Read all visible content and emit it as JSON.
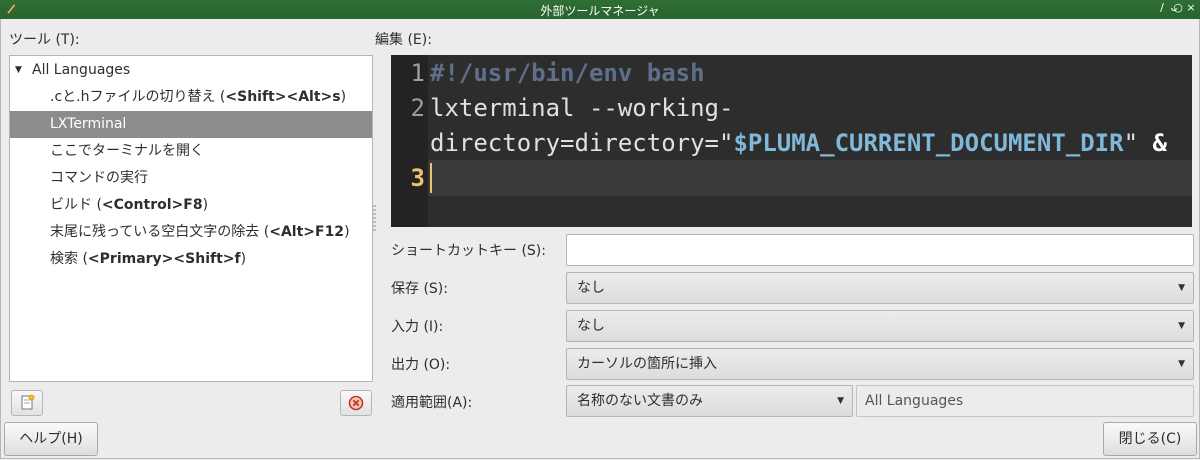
{
  "window": {
    "title": "外部ツールマネージャ",
    "controls": [
      "∕",
      "ᴗ",
      "○",
      "×"
    ]
  },
  "tools_label": "ツール (T):",
  "edit_label": "編集 (E):",
  "tree": {
    "root": "All Languages",
    "items": [
      {
        "name": ".cと.hファイルの切り替え (",
        "shortcut": "<Shift><Alt>s",
        "close": ")"
      },
      {
        "name": "LXTerminal",
        "shortcut": "",
        "close": "",
        "selected": true
      },
      {
        "name": "ここでターミナルを開く",
        "shortcut": "",
        "close": ""
      },
      {
        "name": "コマンドの実行",
        "shortcut": "",
        "close": ""
      },
      {
        "name": "ビルド (",
        "shortcut": "<Control>F8",
        "close": ")"
      },
      {
        "name": "末尾に残っている空白文字の除去 (",
        "shortcut": "<Alt>F12",
        "close": ")"
      },
      {
        "name": "検索 (",
        "shortcut": "<Primary><Shift>f",
        "close": ")"
      }
    ]
  },
  "editor": {
    "line_numbers": [
      "1",
      "2",
      "3"
    ],
    "line1": "#!/usr/bin/env bash",
    "line2a": "lxterminal --working-",
    "line2b_prefix": "directory=directory=\"",
    "line2b_var": "$PLUMA_CURRENT_DOCUMENT_DIR",
    "line2b_suffix": "\" ",
    "line2b_amp": "&"
  },
  "form": {
    "shortcut_label": "ショートカットキー (S):",
    "shortcut_value": "",
    "save_label": "保存 (S):",
    "save_value": "なし",
    "input_label": "入力 (I):",
    "input_value": "なし",
    "output_label": "出力 (O):",
    "output_value": "カーソルの箇所に挿入",
    "scope_label": "適用範囲(A):",
    "scope_value": "名称のない文書のみ",
    "languages_value": "All Languages"
  },
  "buttons": {
    "help": "ヘルプ(H)",
    "close": "閉じる(C)"
  },
  "colors": {
    "titlebar": "#2f6f34",
    "selection": "#8c8c8c",
    "editor_bg": "#2d2d2d",
    "current_line_number": "#e9c46a"
  }
}
